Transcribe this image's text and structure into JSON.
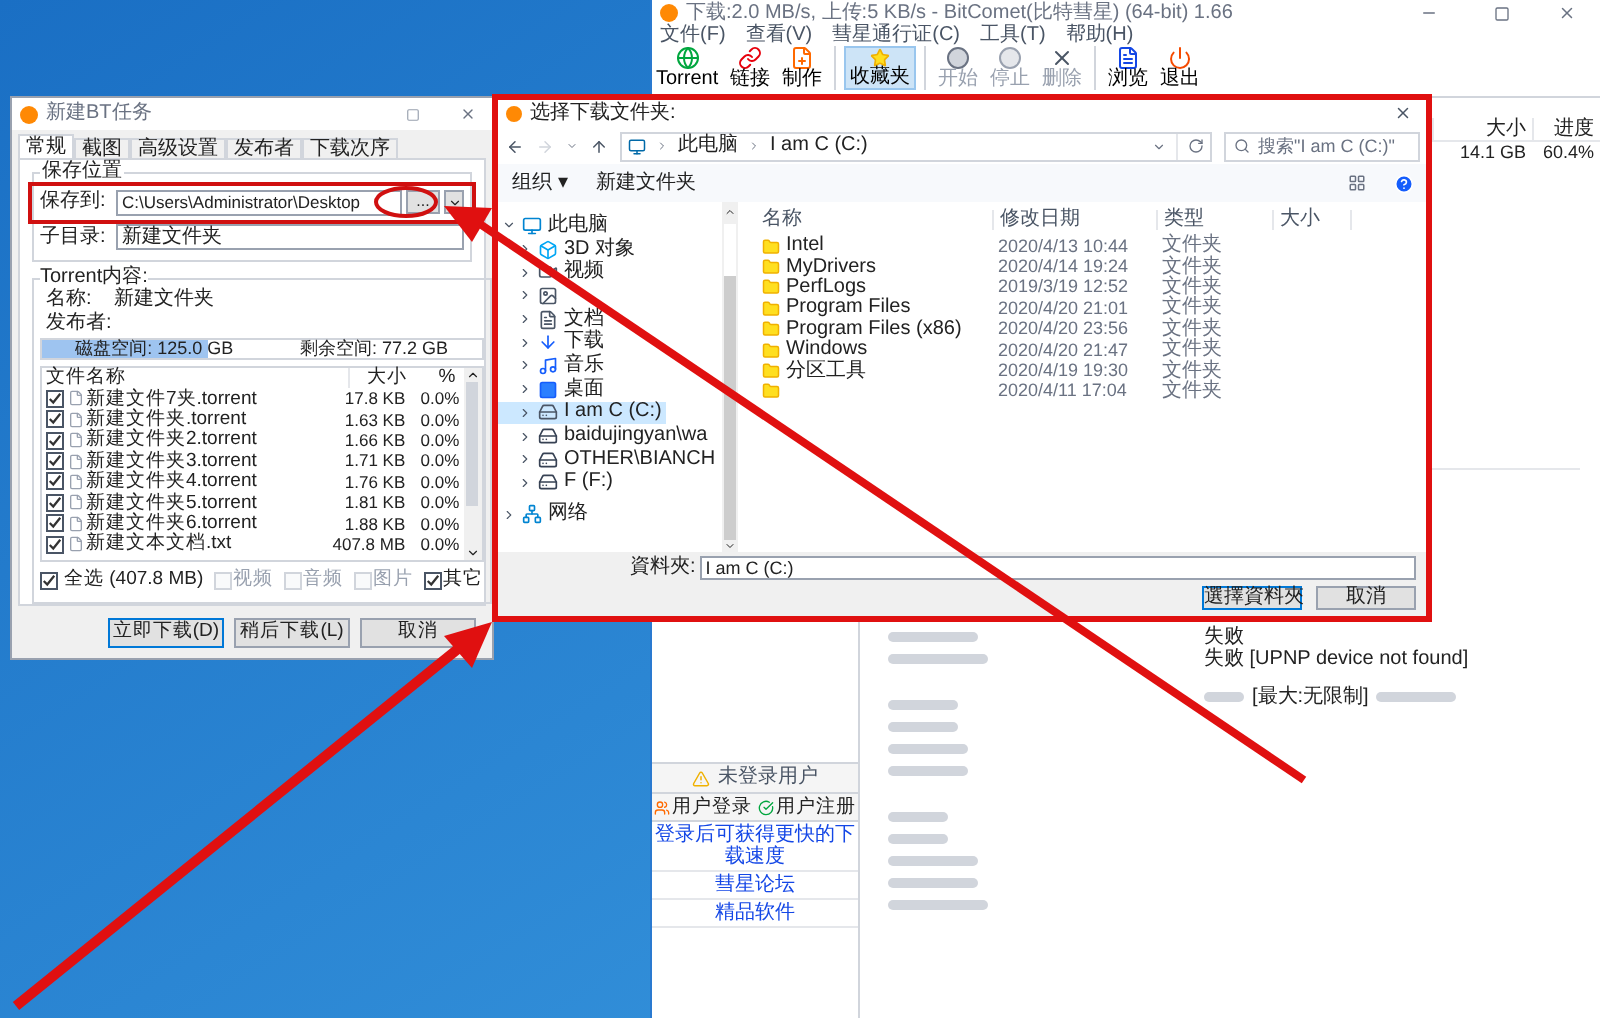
{
  "main_window": {
    "title": "下载:2.0 MB/s, 上传:5 KB/s - BitComet(比特彗星) (64-bit) 1.66",
    "menu": [
      "文件(F)",
      "查看(V)",
      "彗星通行证(C)",
      "工具(T)",
      "帮助(H)"
    ],
    "toolbar": [
      {
        "kind": "torrent",
        "label": "Torrent",
        "selected": false,
        "disabled": false
      },
      {
        "kind": "link",
        "label": "链接",
        "selected": false,
        "disabled": false
      },
      {
        "kind": "make",
        "label": "制作",
        "selected": false,
        "disabled": false
      },
      {
        "kind": "favorites",
        "label": "收藏夹",
        "selected": true,
        "disabled": false
      },
      {
        "kind": "start",
        "label": "开始",
        "selected": false,
        "disabled": true
      },
      {
        "kind": "stop",
        "label": "停止",
        "selected": false,
        "disabled": true
      },
      {
        "kind": "delete",
        "label": "删除",
        "selected": false,
        "disabled": true
      },
      {
        "kind": "browse",
        "label": "浏览",
        "selected": false,
        "disabled": false
      },
      {
        "kind": "exit",
        "label": "退出",
        "selected": false,
        "disabled": false
      }
    ],
    "task_columns": [
      "大小",
      "进度"
    ],
    "task_row": [
      "14.1 GB",
      "60.4%"
    ],
    "user_panel": {
      "status": "未登录用户",
      "buttons": [
        {
          "kind": "login",
          "label": "用户登录"
        },
        {
          "kind": "register",
          "label": "用户注册"
        }
      ],
      "links": [
        "登录后可获得更快的下载速度",
        "彗星论坛",
        "精品软件"
      ]
    },
    "log": [
      {
        "kind": "text",
        "value": "失败"
      },
      {
        "kind": "text",
        "value": "失败 [UPNP device not found]"
      },
      {
        "kind": "speed",
        "value": "[最大:无限制]"
      }
    ]
  },
  "bt_dialog": {
    "title": "新建BT任务",
    "tabs": [
      {
        "label": "常规",
        "selected": true
      },
      {
        "label": "截图",
        "selected": false
      },
      {
        "label": "高级设置",
        "selected": false
      },
      {
        "label": "发布者",
        "selected": false
      },
      {
        "label": "下载次序",
        "selected": false
      }
    ],
    "save_group": "保存位置",
    "save_label": "保存到:",
    "save_path": "C:\\Users\\Administrator\\Desktop",
    "browse_button": "...",
    "subdir_label": "子目录:",
    "subdir_value": "新建文件夹",
    "torrent_group": "Torrent内容:",
    "name_label": "名称:",
    "name_value": "新建文件夹",
    "publisher_label": "发布者:",
    "disk": {
      "level": 0.38,
      "total": "磁盘空间: 125.0 GB",
      "free": "剩余空间: 77.2 GB"
    },
    "columns": [
      "文件名称",
      "大小",
      "%"
    ],
    "files": [
      {
        "name": "新建文件7夹.torrent",
        "size": "17.8 KB",
        "percent": "0.0%",
        "checked": true
      },
      {
        "name": "新建文件夹.torrent",
        "size": "1.63 KB",
        "percent": "0.0%",
        "checked": true
      },
      {
        "name": "新建文件夹2.torrent",
        "size": "1.66 KB",
        "percent": "0.0%",
        "checked": true
      },
      {
        "name": "新建文件夹3.torrent",
        "size": "1.71 KB",
        "percent": "0.0%",
        "checked": true
      },
      {
        "name": "新建文件夹4.torrent",
        "size": "1.76 KB",
        "percent": "0.0%",
        "checked": true
      },
      {
        "name": "新建文件夹5.torrent",
        "size": "1.81 KB",
        "percent": "0.0%",
        "checked": true
      },
      {
        "name": "新建文件夹6.torrent",
        "size": "1.88 KB",
        "percent": "0.0%",
        "checked": true
      },
      {
        "name": "新建文本文档.txt",
        "size": "407.8 MB",
        "percent": "0.0%",
        "checked": true
      }
    ],
    "select_all": {
      "label": "全选 (407.8 MB)",
      "checked": true
    },
    "filters": [
      {
        "label": "视频",
        "checked": false,
        "disabled": true
      },
      {
        "label": "音频",
        "checked": false,
        "disabled": true
      },
      {
        "label": "图片",
        "checked": false,
        "disabled": true
      },
      {
        "label": "其它",
        "checked": true,
        "disabled": false
      }
    ],
    "buttons": [
      {
        "label": "立即下载(D)",
        "selected": true
      },
      {
        "label": "稍后下载(L)",
        "selected": false
      },
      {
        "label": "取消",
        "selected": false
      }
    ]
  },
  "folder_dialog": {
    "title": "选择下载文件夹:",
    "breadcrumb": [
      "此电脑",
      "I am C (C:)"
    ],
    "search_placeholder": "搜索\"I am C (C:)\"",
    "organize": "组织 ▾",
    "new_folder": "新建文件夹",
    "nav": [
      {
        "kind": "pc",
        "label": "此电脑",
        "expanded": true,
        "selected": false,
        "children": [
          {
            "kind": "cube",
            "label": "3D 对象",
            "selected": false
          },
          {
            "kind": "video",
            "label": "视频",
            "selected": false
          },
          {
            "kind": "picture",
            "selected": false
          },
          {
            "kind": "doc",
            "label": "文档",
            "selected": false
          },
          {
            "kind": "download",
            "label": "下载",
            "selected": false
          },
          {
            "kind": "music",
            "label": "音乐",
            "selected": false
          },
          {
            "kind": "desktop",
            "label": "桌面",
            "selected": false
          },
          {
            "kind": "drive",
            "label": "I am C (C:)",
            "selected": true
          },
          {
            "kind": "netdrive",
            "label": "baidujingyan\\wa",
            "selected": false
          },
          {
            "kind": "netdrive",
            "label": "OTHER\\BIANCH",
            "selected": false
          },
          {
            "kind": "netdrive",
            "label": "F (F:)",
            "selected": false
          }
        ]
      },
      {
        "kind": "network",
        "label": "网络",
        "expanded": false,
        "selected": false
      }
    ],
    "columns": [
      "名称",
      "修改日期",
      "类型",
      "大小"
    ],
    "files": [
      {
        "name": "Intel",
        "date": "2020/4/13 10:44",
        "type": "文件夹"
      },
      {
        "name": "MyDrivers",
        "date": "2020/4/14 19:24",
        "type": "文件夹"
      },
      {
        "name": "PerfLogs",
        "date": "2019/3/19 12:52",
        "type": "文件夹"
      },
      {
        "name": "Program Files",
        "date": "2020/4/20 21:01",
        "type": "文件夹"
      },
      {
        "name": "Program Files (x86)",
        "date": "2020/4/20 23:56",
        "type": "文件夹"
      },
      {
        "name": "Windows",
        "date": "2020/4/20 21:47",
        "type": "文件夹"
      },
      {
        "name": "分区工具",
        "date": "2020/4/19 19:30",
        "type": "文件夹"
      },
      {
        "date": "2020/4/11 17:04",
        "type": "文件夹"
      }
    ],
    "folder_label": "資料夾:",
    "folder_value": "I am C (C:)",
    "buttons": [
      {
        "label": "選擇資料夾",
        "selected": true
      },
      {
        "label": "取消",
        "selected": false
      }
    ]
  }
}
